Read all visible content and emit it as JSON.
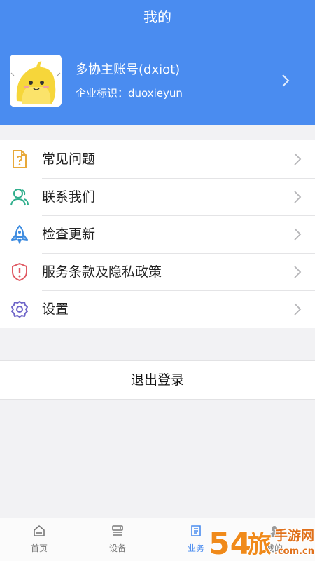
{
  "header": {
    "title": "我的",
    "account_name": "多协主账号(dxiot)",
    "company_id": "企业标识：duoxieyun"
  },
  "menu": {
    "items": [
      {
        "label": "常见问题",
        "icon": "faq-document-icon",
        "color": "#e8a93a"
      },
      {
        "label": "联系我们",
        "icon": "contacts-icon",
        "color": "#2fae8c"
      },
      {
        "label": "检查更新",
        "icon": "rocket-icon",
        "color": "#3c8be0"
      },
      {
        "label": "服务条款及隐私政策",
        "icon": "shield-alert-icon",
        "color": "#e05a63"
      },
      {
        "label": "设置",
        "icon": "gear-icon",
        "color": "#6f66c9"
      }
    ]
  },
  "logout_label": "退出登录",
  "tabbar": {
    "tabs": [
      {
        "label": "首页",
        "icon": "home-icon",
        "active": false
      },
      {
        "label": "设备",
        "icon": "device-icon",
        "active": false
      },
      {
        "label": "业务",
        "icon": "book-icon",
        "active": true
      },
      {
        "label": "我的",
        "icon": "user-icon",
        "active": false
      }
    ]
  },
  "watermark": {
    "brand": "54旅",
    "text": "手游网",
    "domain": ".com.cn"
  },
  "colors": {
    "primary": "#4a8cf0",
    "background": "#f2f2f4"
  }
}
